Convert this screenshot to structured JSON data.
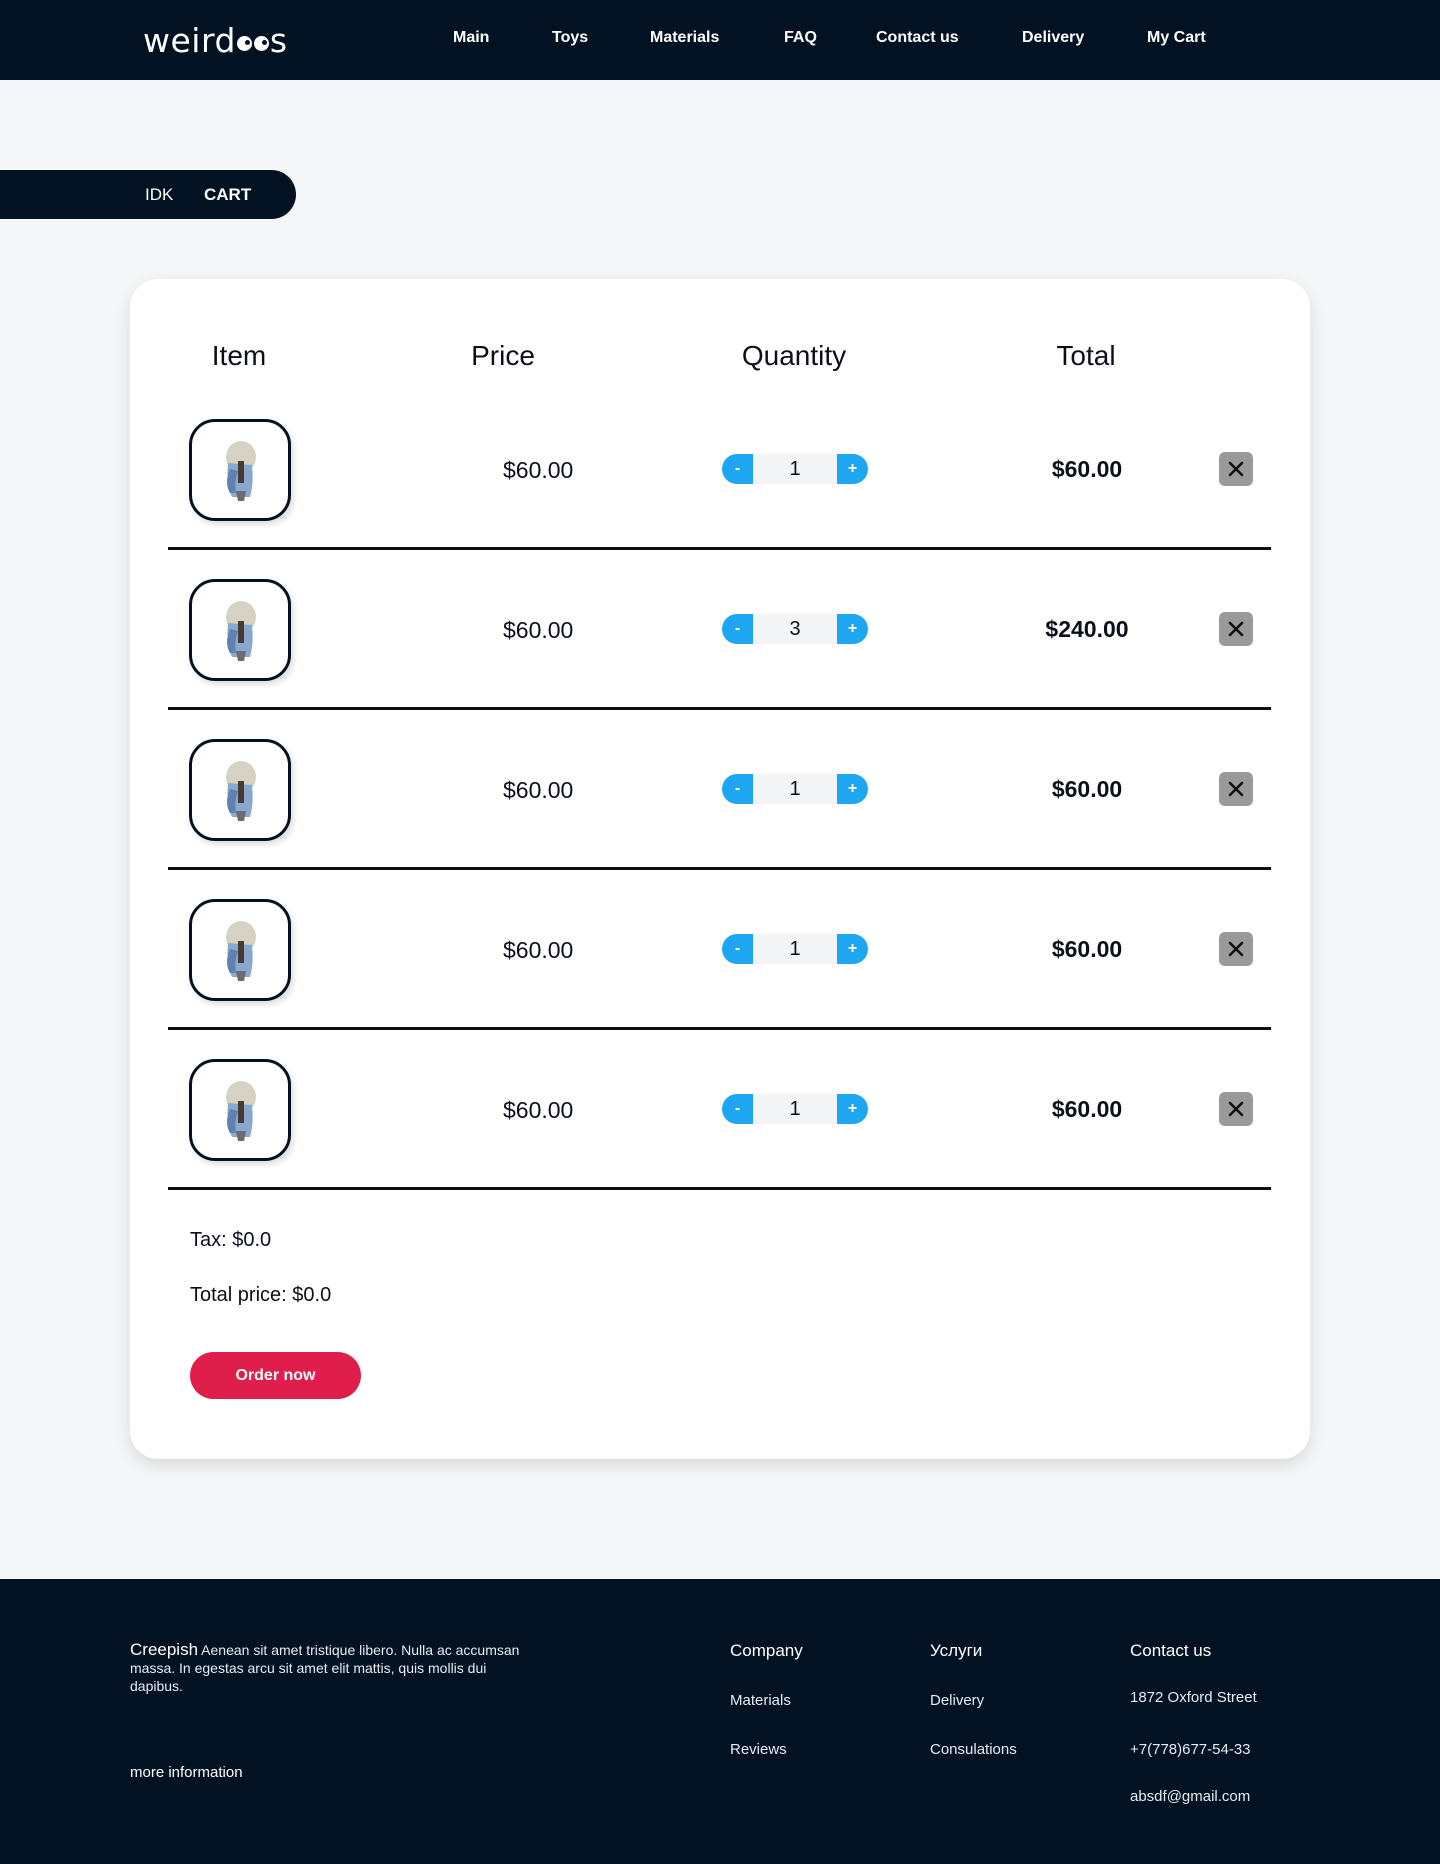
{
  "header": {
    "logo_text": "weird",
    "logo_tail": "s",
    "nav": [
      "Main",
      "Toys",
      "Materials",
      "FAQ",
      "Contact us",
      "Delivery",
      "My Cart"
    ]
  },
  "breadcrumb": {
    "parent": "IDK",
    "current": "CART"
  },
  "cart": {
    "columns": {
      "item": "Item",
      "price": "Price",
      "quantity": "Quantity",
      "total": "Total"
    },
    "rows": [
      {
        "price": "$60.00",
        "quantity": "1",
        "total": "$60.00"
      },
      {
        "price": "$60.00",
        "quantity": "3",
        "total": "$240.00"
      },
      {
        "price": "$60.00",
        "quantity": "1",
        "total": "$60.00"
      },
      {
        "price": "$60.00",
        "quantity": "1",
        "total": "$60.00"
      },
      {
        "price": "$60.00",
        "quantity": "1",
        "total": "$60.00"
      }
    ],
    "minus_label": "-",
    "plus_label": "+",
    "tax": "Tax: $0.0",
    "total_price": "Total price: $0.0",
    "order_button": "Order now"
  },
  "footer": {
    "brand": "Creepish",
    "about": " Aenean sit amet tristique libero. Nulla ac accumsan massa. In egestas arcu sit amet elit mattis, quis mollis dui dapibus.",
    "more": "more information",
    "company": {
      "title": "Company",
      "links": [
        "Materials",
        "Reviews"
      ]
    },
    "services": {
      "title": "Услуги",
      "links": [
        "Delivery",
        "Consulations"
      ]
    },
    "contact": {
      "title": "Contact us",
      "address": "1872 Oxford Street",
      "phone": "+7(778)677-54-33",
      "email": "absdf@gmail.com"
    }
  },
  "colors": {
    "navy": "#021222",
    "accent_blue": "#1ea7f0",
    "order_red": "#e01e4b",
    "remove_gray": "#9a9a9a",
    "background": "#f5f6f8"
  },
  "icons": [
    "toy-figure-thumbnail",
    "close-icon"
  ]
}
